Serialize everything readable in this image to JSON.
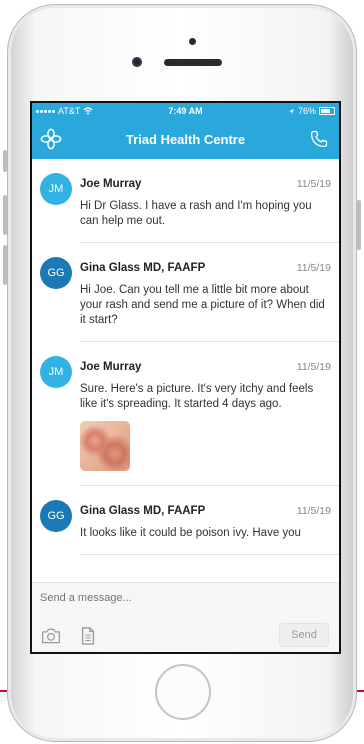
{
  "status_bar": {
    "carrier": "AT&T",
    "time": "7:49 AM",
    "battery": "76%"
  },
  "header": {
    "title": "Triad Health Centre"
  },
  "messages": [
    {
      "initials": "JM",
      "sender": "Joe Murray",
      "date": "11/5/19",
      "text": "Hi Dr Glass. I have a rash and I'm hoping you can help me out."
    },
    {
      "initials": "GG",
      "sender": "Gina Glass MD, FAAFP",
      "date": "11/5/19",
      "text": "Hi Joe. Can you tell me a little bit more about your rash and send me a picture of it? When did it start?"
    },
    {
      "initials": "JM",
      "sender": "Joe Murray",
      "date": "11/5/19",
      "text": "Sure. Here's a picture. It's very itchy and feels like it's spreading. It started 4 days ago."
    },
    {
      "initials": "GG",
      "sender": "Gina Glass MD, FAAFP",
      "date": "11/5/19",
      "text": "It looks like it could be poison ivy. Have you"
    }
  ],
  "composer": {
    "placeholder": "Send a message...",
    "send_label": "Send"
  },
  "colors": {
    "brand": "#2aa8dc",
    "avatar_patient": "#31b2e3",
    "avatar_doctor": "#1b79b5"
  },
  "icons": [
    "app-logo-icon",
    "phone-call-icon",
    "camera-icon",
    "document-icon",
    "wifi-icon",
    "location-arrow-icon",
    "battery-icon"
  ]
}
